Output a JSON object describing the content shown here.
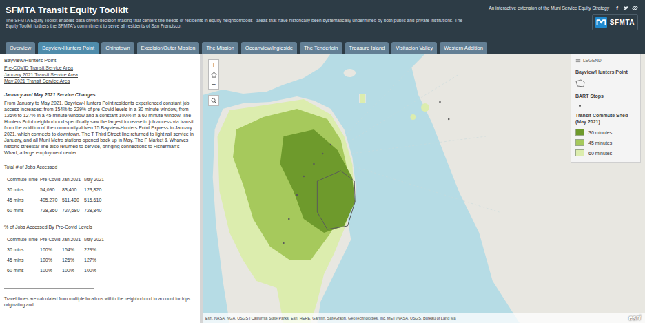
{
  "header": {
    "title": "SFMTA Transit Equity Toolkit",
    "description": "The SFMTA Equity Toolkit enables data driven decision making that centers the needs of residents in equity neighborhoods– areas that have historically been systematically undermined by both public and private institutions. The Equity Toolkit furthers the SFMTA's commitment to serve all residents of San Francisco.",
    "tagline": "An interactive extension of the Muni Service Equity Strategy",
    "facebook_glyph": "f",
    "logo": "SFMTA"
  },
  "tabs": [
    {
      "label": "Overview",
      "selected": false
    },
    {
      "label": "Bayview-Hunters Point",
      "selected": true
    },
    {
      "label": "Chinatown",
      "selected": false
    },
    {
      "label": "Excelsior/Outer Mission",
      "selected": false
    },
    {
      "label": "The Mission",
      "selected": false
    },
    {
      "label": "Oceanview/Ingleside",
      "selected": false
    },
    {
      "label": "The Tenderloin",
      "selected": false
    },
    {
      "label": "Treasure Island",
      "selected": false
    },
    {
      "label": "Visitacion Valley",
      "selected": false
    },
    {
      "label": "Western Addition",
      "selected": false
    }
  ],
  "sidebar": {
    "title": "Bayview/Hunters Point",
    "links": [
      "Pre-COVID Transit Service Area",
      "January 2021 Transit Service Area",
      "May 2021 Transit Service Area"
    ],
    "heading": "January and May 2021 Service Changes",
    "paragraph": "From January to May 2021, Bayview-Hunters Point residents experienced constant job access increases: from 154% to 229% of pre-Covid levels in a 30 minute window, from 126% to 127% in a 45 minute window and a constant 100% in a 60 minute window. The Hunters Point neighborhood specifically saw the largest increase in job access via transit from the addition of the community-driven 15 Bayview-Hunters Point Express in January 2021, which connects to downtown. The T Third Street line returned to light rail service in January, and all Muni Metro stations opened back up in May. The F Market & Wharves historic streetcar line also returned to service, bringing connections to Fisherman's Wharf, a large employment center.",
    "tables": [
      {
        "title": "Total # of Jobs Accessed",
        "columns": [
          "Commute Time",
          "Pre-Covid",
          "Jan 2021",
          "May 2021"
        ],
        "rows": [
          [
            "30 mins",
            "54,090",
            "83,460",
            "123,820"
          ],
          [
            "45 mins",
            "405,270",
            "511,480",
            "515,610"
          ],
          [
            "60 mins",
            "728,360",
            "727,680",
            "728,840"
          ]
        ]
      },
      {
        "title": "% of Jobs Accessed By Pre-Covid Levels",
        "columns": [
          "Commute Time",
          "Pre-Covid",
          "Jan 2021",
          "May 2021"
        ],
        "rows": [
          [
            "30 mins",
            "100%",
            "154%",
            "229%"
          ],
          [
            "45 mins",
            "100%",
            "126%",
            "127%"
          ],
          [
            "60 mins",
            "100%",
            "100%",
            "100%"
          ]
        ]
      }
    ],
    "footnote": "Travel times are calculated from multiple locations within the neighborhood to account for trips originating and"
  },
  "map": {
    "controls": {
      "zoom_in": "+",
      "zoom_out": "−"
    },
    "legend": {
      "title": "LEGEND",
      "groups": [
        {
          "title": "Bayview/Hunters Point",
          "kind": "polygon",
          "items": []
        },
        {
          "title": "BART Stops",
          "kind": "point",
          "items": []
        },
        {
          "title": "Transit Commute Shed (May 2021)",
          "kind": "swatches",
          "items": [
            {
              "label": "30 minutes",
              "color": "#6e9a2c"
            },
            {
              "label": "45 minutes",
              "color": "#a6c95c"
            },
            {
              "label": "60 minutes",
              "color": "#dcedae"
            }
          ]
        }
      ]
    },
    "attribution": "Esri, NASA, NGA, USGS | California State Parks, Esri, HERE, Garmin, SafeGraph, GeoTechnologies, Inc, METI/NASA, USGS, Bureau of Land Ma",
    "logo": "esri"
  }
}
